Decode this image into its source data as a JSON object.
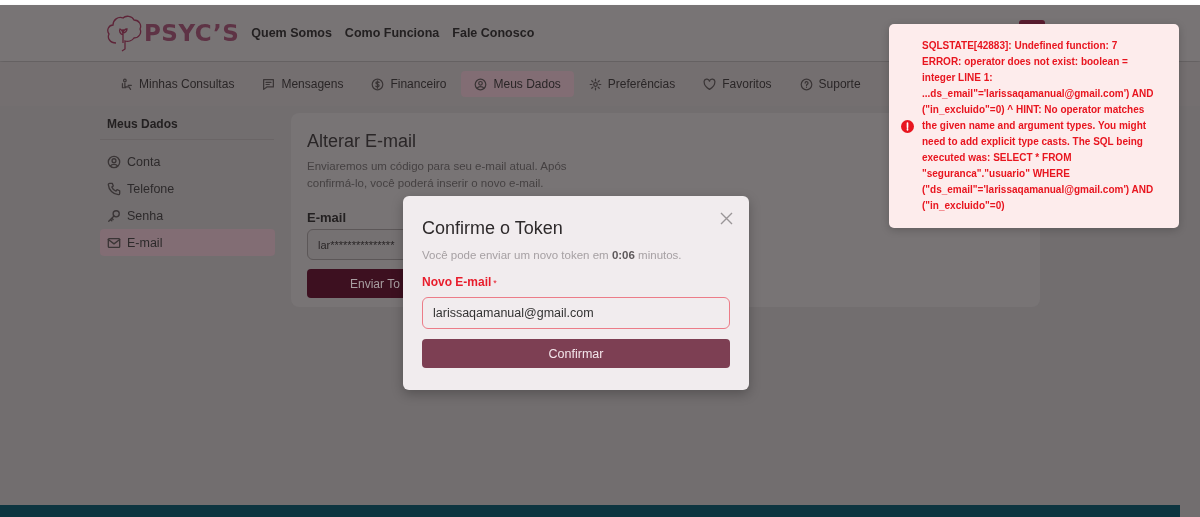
{
  "header": {
    "logo": "PSYC’S",
    "links": [
      "Quem Somos",
      "Como Funciona",
      "Fale Conosco"
    ]
  },
  "tabs": [
    {
      "label": "Minhas Consultas",
      "selected": false
    },
    {
      "label": "Mensagens",
      "selected": false
    },
    {
      "label": "Financeiro",
      "selected": false
    },
    {
      "label": "Meus Dados",
      "selected": true
    },
    {
      "label": "Preferências",
      "selected": false
    },
    {
      "label": "Favoritos",
      "selected": false
    },
    {
      "label": "Suporte",
      "selected": false
    }
  ],
  "sidebar": {
    "title": "Meus Dados",
    "items": [
      {
        "label": "Conta",
        "selected": false
      },
      {
        "label": "Telefone",
        "selected": false
      },
      {
        "label": "Senha",
        "selected": false
      },
      {
        "label": "E-mail",
        "selected": true
      }
    ]
  },
  "card": {
    "title": "Alterar E-mail",
    "description": "Enviaremos um código para seu e-mail atual. Após confirmá-lo, você poderá inserir o novo e-mail.",
    "field_label": "E-mail",
    "field_value": "lar***************",
    "button": "Enviar To"
  },
  "modal": {
    "title": "Confirme o Token",
    "message": "Você pode enviar um novo token em **0:06** minutos.",
    "field_label": "Novo E-mail",
    "required_mark": "*",
    "field_value": "larissaqamanual@gmail.com",
    "button": "Confirmar"
  },
  "toast": {
    "message": "SQLSTATE[42883]: Undefined function: 7 ERROR: operator does not exist: boolean = integer LINE 1: ...ds_email\"='larissaqamanual@gmail.com') AND (\"in_excluido\"=0) ^ HINT: No operator matches the given name and argument types. You might need to add explicit type casts. The SQL being executed was: SELECT * FROM \"seguranca\".\"usuario\" WHERE (\"ds_email\"='larissaqamanual@gmail.com') AND (\"in_excluido\"=0)"
  }
}
